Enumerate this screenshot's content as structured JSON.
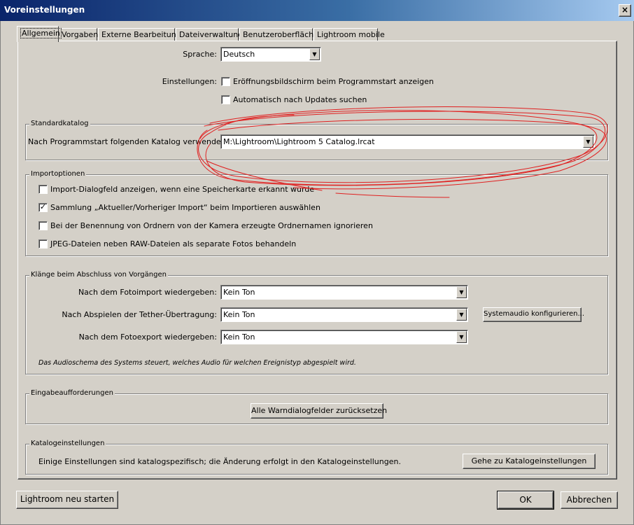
{
  "window": {
    "title": "Voreinstellungen",
    "close_glyph": "×"
  },
  "tabs": [
    {
      "label": "Allgemein"
    },
    {
      "label": "Vorgaben"
    },
    {
      "label": "Externe Bearbeitung"
    },
    {
      "label": "Dateiverwaltung"
    },
    {
      "label": "Benutzeroberfläche"
    },
    {
      "label": "Lightroom mobile"
    }
  ],
  "language": {
    "label": "Sprache:",
    "value": "Deutsch"
  },
  "settings": {
    "label": "Einstellungen:",
    "splash": {
      "label": "Eröffnungsbildschirm beim Programmstart anzeigen",
      "checked": false
    },
    "updates": {
      "label": "Automatisch nach Updates suchen",
      "checked": false
    }
  },
  "default_catalog": {
    "legend": "Standardkatalog",
    "label": "Nach Programmstart folgenden Katalog verwenden:",
    "value": "M:\\Lightroom\\Lightroom 5 Catalog.lrcat"
  },
  "import_options": {
    "legend": "Importoptionen",
    "items": [
      {
        "label": "Import-Dialogfeld anzeigen, wenn eine Speicherkarte erkannt wurde",
        "checked": false
      },
      {
        "label": "Sammlung „Aktueller/Vorheriger Import“ beim Importieren auswählen",
        "checked": true
      },
      {
        "label": "Bei der Benennung von Ordnern von der Kamera erzeugte Ordnernamen ignorieren",
        "checked": false
      },
      {
        "label": "JPEG-Dateien neben RAW-Dateien als separate Fotos behandeln",
        "checked": false
      }
    ]
  },
  "sounds": {
    "legend": "Klänge beim Abschluss von Vorgängen",
    "import_label": "Nach dem Fotoimport wiedergeben:",
    "import_value": "Kein Ton",
    "tether_label": "Nach Abspielen der Tether-Übertragung:",
    "tether_value": "Kein Ton",
    "export_label": "Nach dem Fotoexport wiedergeben:",
    "export_value": "Kein Ton",
    "system_audio_button": "Systemaudio konfigurieren...",
    "note": "Das Audioschema des Systems steuert, welches Audio für welchen Ereignistyp abgespielt wird."
  },
  "prompts": {
    "legend": "Eingabeaufforderungen",
    "reset_button": "Alle Warndialogfelder zurücksetzen"
  },
  "catalog_settings": {
    "legend": "Katalogeinstellungen",
    "text": "Einige Einstellungen sind katalogspezifisch; die Änderung erfolgt in den Katalogeinstellungen.",
    "goto_button": "Gehe zu Katalogeinstellungen"
  },
  "footer": {
    "restart_button": "Lightroom neu starten",
    "ok_button": "OK",
    "cancel_button": "Abbrechen"
  },
  "icons": {
    "dropdown": "triangle-down-icon",
    "check": "check-icon"
  },
  "colors": {
    "annotation": "#e02020",
    "titlebar": "#0a246a",
    "face": "#d4d0c8"
  }
}
